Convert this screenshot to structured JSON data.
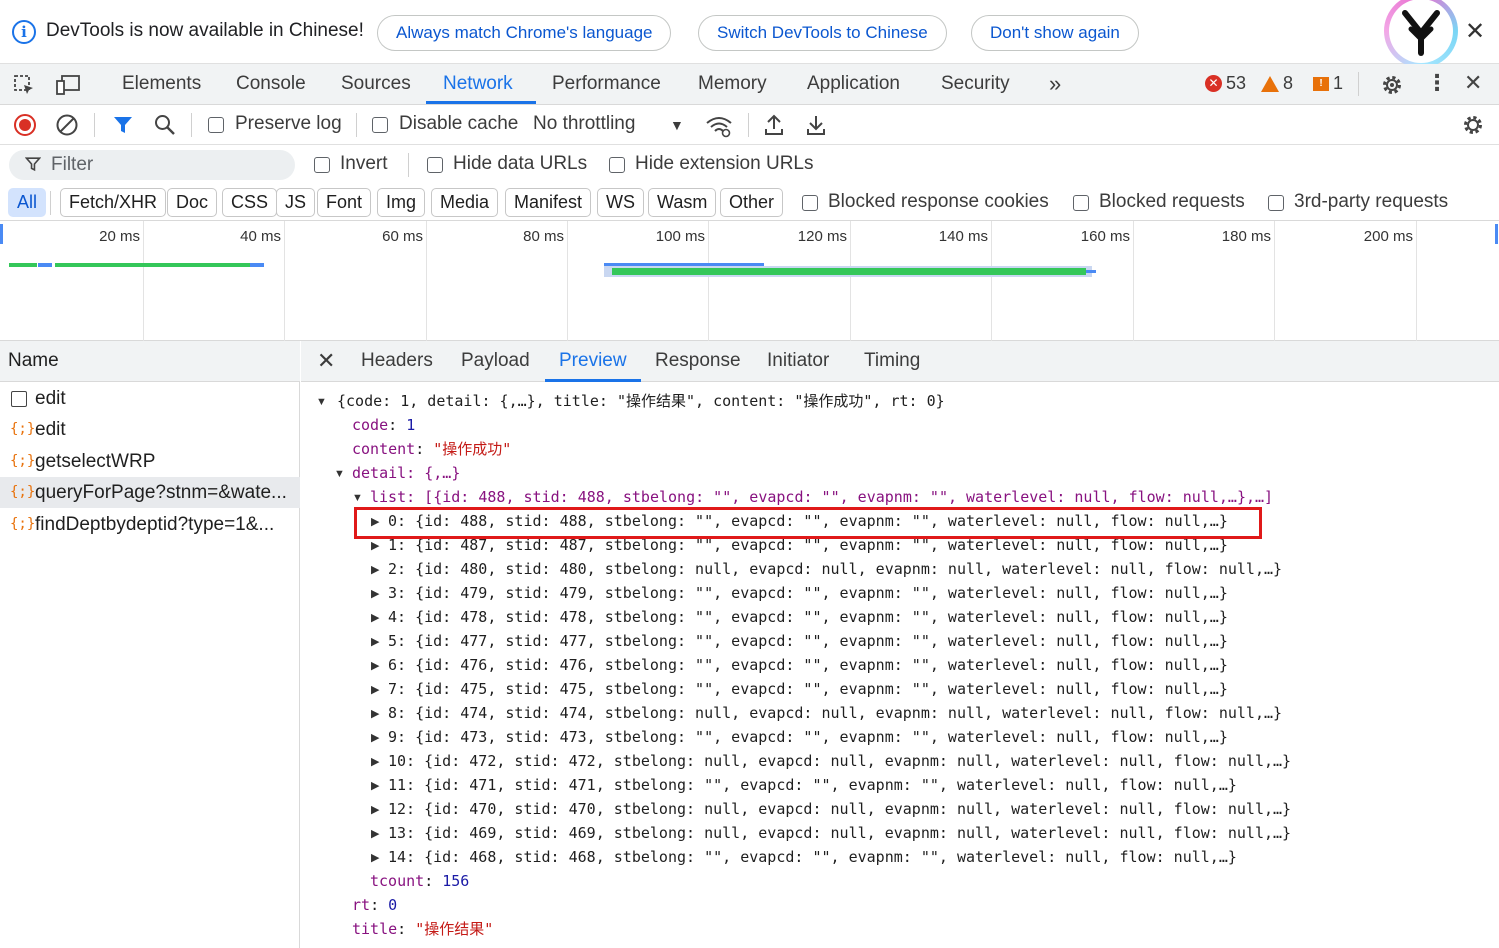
{
  "banner": {
    "message": "DevTools is now available in Chinese!",
    "btn_match": "Always match Chrome's language",
    "btn_switch": "Switch DevTools to Chinese",
    "btn_dont_show": "Don't show again"
  },
  "tabs": {
    "elements": "Elements",
    "console": "Console",
    "sources": "Sources",
    "network": "Network",
    "performance": "Performance",
    "memory": "Memory",
    "application": "Application",
    "security": "Security",
    "more": "»"
  },
  "counts": {
    "errors": "53",
    "warnings": "8",
    "issues": "1"
  },
  "toolbar": {
    "preserve_log": "Preserve log",
    "disable_cache": "Disable cache",
    "throttling": "No throttling"
  },
  "filter": {
    "placeholder": "Filter",
    "invert": "Invert",
    "hide_data_urls": "Hide data URLs",
    "hide_extension_urls": "Hide extension URLs"
  },
  "types": {
    "all": "All",
    "fetch": "Fetch/XHR",
    "doc": "Doc",
    "css": "CSS",
    "js": "JS",
    "font": "Font",
    "img": "Img",
    "media": "Media",
    "manifest": "Manifest",
    "ws": "WS",
    "wasm": "Wasm",
    "other": "Other",
    "blocked_cookies": "Blocked response cookies",
    "blocked_requests": "Blocked requests",
    "third_party": "3rd-party requests"
  },
  "timeline": {
    "ticks": [
      "20 ms",
      "40 ms",
      "60 ms",
      "80 ms",
      "100 ms",
      "120 ms",
      "140 ms",
      "160 ms",
      "180 ms",
      "200 ms"
    ]
  },
  "requests": {
    "header": "Name",
    "items": [
      {
        "name": "edit",
        "icon": "document-icon"
      },
      {
        "name": "edit",
        "icon": "xhr-icon"
      },
      {
        "name": "getselectWRP",
        "icon": "xhr-icon"
      },
      {
        "name": "queryForPage?stnm=&wate...",
        "icon": "xhr-icon"
      },
      {
        "name": "findDeptbydeptid?type=1&...",
        "icon": "xhr-icon"
      }
    ]
  },
  "detail_tabs": {
    "headers": "Headers",
    "payload": "Payload",
    "preview": "Preview",
    "response": "Response",
    "initiator": "Initiator",
    "timing": "Timing"
  },
  "preview": {
    "root": "{code: 1, detail: {,…}, title: \"操作结果\", content: \"操作成功\", rt: 0}",
    "code_key": "code",
    "code_val": "1",
    "content_key": "content",
    "content_val": "\"操作成功\"",
    "detail_line": "detail: {,…}",
    "list_line": "list: [{id: 488, stid: 488, stbelong: \"\", evapcd: \"\", evapnm: \"\", waterlevel: null, flow: null,…},…]",
    "items": [
      "0: {id: 488, stid: 488, stbelong: \"\", evapcd: \"\", evapnm: \"\", waterlevel: null, flow: null,…}",
      "1: {id: 487, stid: 487, stbelong: \"\", evapcd: \"\", evapnm: \"\", waterlevel: null, flow: null,…}",
      "2: {id: 480, stid: 480, stbelong: null, evapcd: null, evapnm: null, waterlevel: null, flow: null,…}",
      "3: {id: 479, stid: 479, stbelong: \"\", evapcd: \"\", evapnm: \"\", waterlevel: null, flow: null,…}",
      "4: {id: 478, stid: 478, stbelong: \"\", evapcd: \"\", evapnm: \"\", waterlevel: null, flow: null,…}",
      "5: {id: 477, stid: 477, stbelong: \"\", evapcd: \"\", evapnm: \"\", waterlevel: null, flow: null,…}",
      "6: {id: 476, stid: 476, stbelong: \"\", evapcd: \"\", evapnm: \"\", waterlevel: null, flow: null,…}",
      "7: {id: 475, stid: 475, stbelong: \"\", evapcd: \"\", evapnm: \"\", waterlevel: null, flow: null,…}",
      "8: {id: 474, stid: 474, stbelong: null, evapcd: null, evapnm: null, waterlevel: null, flow: null,…}",
      "9: {id: 473, stid: 473, stbelong: \"\", evapcd: \"\", evapnm: \"\", waterlevel: null, flow: null,…}",
      "10: {id: 472, stid: 472, stbelong: null, evapcd: null, evapnm: null, waterlevel: null, flow: null,…}",
      "11: {id: 471, stid: 471, stbelong: \"\", evapcd: \"\", evapnm: \"\", waterlevel: null, flow: null,…}",
      "12: {id: 470, stid: 470, stbelong: null, evapcd: null, evapnm: null, waterlevel: null, flow: null,…}",
      "13: {id: 469, stid: 469, stbelong: null, evapcd: null, evapnm: null, waterlevel: null, flow: null,…}",
      "14: {id: 468, stid: 468, stbelong: \"\", evapcd: \"\", evapnm: \"\", waterlevel: null, flow: null,…}"
    ],
    "tcount_key": "tcount",
    "tcount_val": "156",
    "rt_key": "rt",
    "rt_val": "0",
    "title_key": "title",
    "title_val": "\"操作结果\""
  },
  "colors": {
    "accent": "#1a73e8",
    "highlight_box": "#e01919",
    "timeline_green": "#34c759",
    "timeline_blue": "#4a8af4"
  }
}
